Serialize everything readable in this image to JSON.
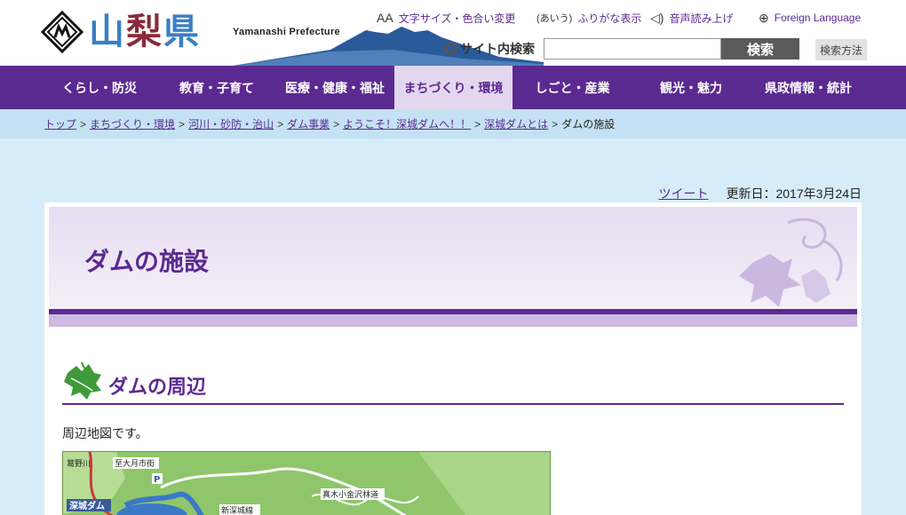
{
  "header": {
    "logo_kanji": [
      "山",
      "梨",
      "県"
    ],
    "logo_en": "Yamanashi Prefecture",
    "util_links": [
      {
        "icon": "text-size-icon",
        "glyph": "AA",
        "label": "文字サイズ・色合い変更"
      },
      {
        "icon": "furigana-icon",
        "glyph": "(あいう)",
        "label": "ふりがな表示"
      },
      {
        "icon": "speaker-icon",
        "glyph": "◁)",
        "label": "音声読み上げ"
      },
      {
        "icon": "globe-icon",
        "glyph": "⊕",
        "label": "Foreign Language"
      }
    ],
    "search": {
      "label": "サイト内検索",
      "value": "",
      "button": "検索",
      "method": "検索方法"
    }
  },
  "nav": {
    "items": [
      {
        "label": "くらし・防災"
      },
      {
        "label": "教育・子育て"
      },
      {
        "label": "医療・健康・福祉"
      },
      {
        "label": "まちづくり・環境",
        "active": true
      },
      {
        "label": "しごと・産業"
      },
      {
        "label": "観光・魅力"
      },
      {
        "label": "県政情報・統計"
      }
    ]
  },
  "breadcrumb": {
    "links": [
      "トップ",
      "まちづくり・環境",
      "河川・砂防・治山",
      "ダム事業",
      "ようこそ！深城ダムへ！！",
      "深城ダムとは"
    ],
    "separator": ">",
    "current": "ダムの施設"
  },
  "meta": {
    "tweet": "ツイート",
    "updated": "更新日：2017年3月24日"
  },
  "page": {
    "title": "ダムの施設",
    "section_heading": "ダムの周辺",
    "paragraph": "周辺地図です。"
  },
  "map": {
    "labels": [
      "至大月市街",
      "葛野川",
      "深城ダム",
      "新深城線",
      "真木小金沢林道",
      "P"
    ]
  },
  "colors": {
    "brand_purple": "#5b2a91",
    "nav_active_bg": "#e3d7f0",
    "breadcrumb_bg": "#c4e2f4",
    "page_bg": "#d6ecf8"
  }
}
